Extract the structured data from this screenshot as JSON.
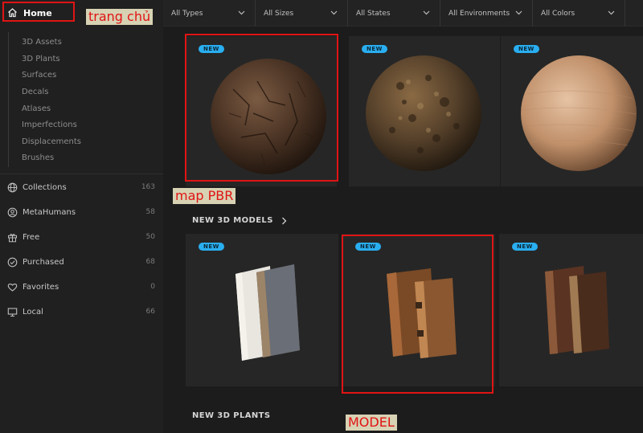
{
  "sidebar": {
    "home": {
      "label": "Home",
      "icon": "home-icon"
    },
    "sub_items": [
      "3D Assets",
      "3D Plants",
      "Surfaces",
      "Decals",
      "Atlases",
      "Imperfections",
      "Displacements",
      "Brushes"
    ],
    "nav_items": [
      {
        "label": "Collections",
        "count": "163",
        "icon": "globe-icon"
      },
      {
        "label": "MetaHumans",
        "count": "58",
        "icon": "user-icon"
      },
      {
        "label": "Free",
        "count": "50",
        "icon": "gift-icon"
      },
      {
        "label": "Purchased",
        "count": "68",
        "icon": "check-circle-icon"
      },
      {
        "label": "Favorites",
        "count": "0",
        "icon": "heart-icon"
      },
      {
        "label": "Local",
        "count": "66",
        "icon": "monitor-icon"
      }
    ]
  },
  "filters": [
    "All Types",
    "All Sizes",
    "All States",
    "All Environments",
    "All Colors"
  ],
  "badge_label": "NEW",
  "sections": {
    "models_title": "NEW 3D MODELS",
    "plants_title": "NEW 3D PLANTS"
  },
  "annotations": {
    "home": "trang chủ",
    "surfaces": "map PBR",
    "models": "MODEL"
  },
  "colors": {
    "accent_badge": "#29aef0",
    "annotation_red": "#e01414",
    "annotation_bg": "#d8d2b4"
  }
}
